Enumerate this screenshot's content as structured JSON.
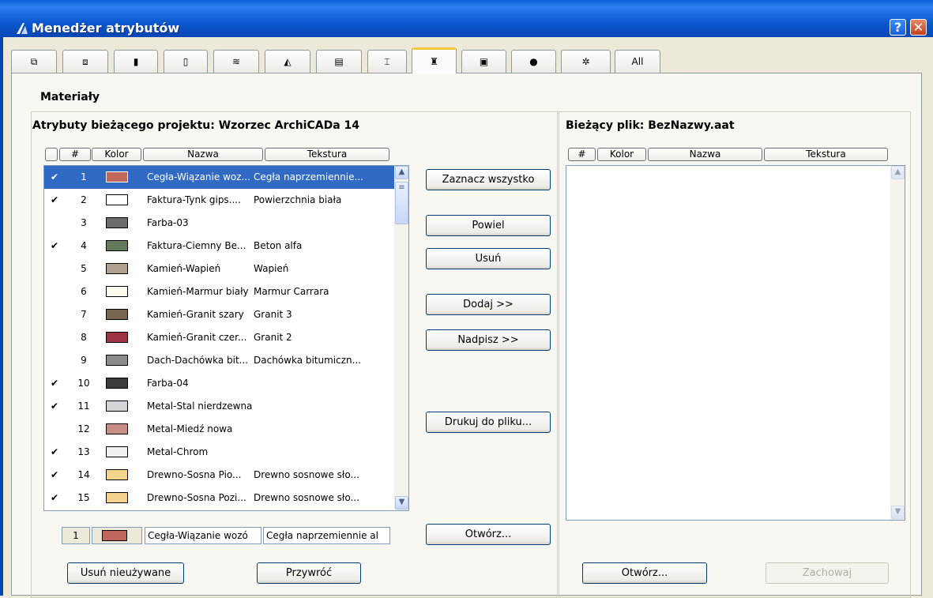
{
  "window": {
    "title": "Menedżer atrybutów",
    "help_label": "?",
    "close_label": "✕"
  },
  "tabs": [
    {
      "label": "",
      "icon": "layers-icon"
    },
    {
      "label": "",
      "icon": "layer-combinations-icon"
    },
    {
      "label": "",
      "icon": "pens-colors-icon"
    },
    {
      "label": "",
      "icon": "pen-sets-icon"
    },
    {
      "label": "",
      "icon": "line-types-icon"
    },
    {
      "label": "",
      "icon": "fill-types-icon"
    },
    {
      "label": "",
      "icon": "composites-icon"
    },
    {
      "label": "",
      "icon": "profiles-icon"
    },
    {
      "label": "",
      "icon": "materials-icon",
      "active": true
    },
    {
      "label": "",
      "icon": "zones-icon"
    },
    {
      "label": "",
      "icon": "cities-icon"
    },
    {
      "label": "",
      "icon": "mep-systems-icon"
    },
    {
      "label": "All",
      "icon": ""
    }
  ],
  "section_title": "Materiały",
  "left": {
    "title": "Atrybuty bieżącego projektu: Wzorzec ArchiCADa 14",
    "headers": {
      "check": "",
      "num": "#",
      "color": "Kolor",
      "name": "Nazwa",
      "texture": "Tekstura"
    },
    "rows": [
      {
        "checked": "✔",
        "num": "1",
        "color": "#c0665c",
        "name": "Cegła-Wiązanie woz...",
        "texture": "Cegła naprzemiennie...",
        "selected": true
      },
      {
        "checked": "✔",
        "num": "2",
        "color": "#ffffff",
        "name": "Faktura-Tynk gips....",
        "texture": "Powierzchnia biała"
      },
      {
        "checked": "",
        "num": "3",
        "color": "#6b6b6b",
        "name": "Farba-03",
        "texture": ""
      },
      {
        "checked": "✔",
        "num": "4",
        "color": "#637a5c",
        "name": "Faktura-Ciemny Be...",
        "texture": "Beton alfa"
      },
      {
        "checked": "",
        "num": "5",
        "color": "#b0a28c",
        "name": "Kamień-Wapień",
        "texture": "Wapień"
      },
      {
        "checked": "",
        "num": "6",
        "color": "#fcfbec",
        "name": "Kamień-Marmur biały",
        "texture": "Marmur Carrara"
      },
      {
        "checked": "",
        "num": "7",
        "color": "#7a6450",
        "name": "Kamień-Granit szary",
        "texture": "Granit 3"
      },
      {
        "checked": "",
        "num": "8",
        "color": "#9c3444",
        "name": "Kamień-Granit czer...",
        "texture": "Granit 2"
      },
      {
        "checked": "",
        "num": "9",
        "color": "#8c8c8c",
        "name": "Dach-Dachówka bit...",
        "texture": "Dachówka bitumiczn..."
      },
      {
        "checked": "✔",
        "num": "10",
        "color": "#3c3c3c",
        "name": "Farba-04",
        "texture": ""
      },
      {
        "checked": "✔",
        "num": "11",
        "color": "#d4d4d8",
        "name": "Metal-Stal nierdzewna",
        "texture": ""
      },
      {
        "checked": "",
        "num": "12",
        "color": "#c89084",
        "name": "Metal-Miedź nowa",
        "texture": ""
      },
      {
        "checked": "✔",
        "num": "13",
        "color": "#f0f0f0",
        "name": "Metal-Chrom",
        "texture": ""
      },
      {
        "checked": "✔",
        "num": "14",
        "color": "#f4d48c",
        "name": "Drewno-Sosna Pio...",
        "texture": "Drewno sosnowe sło..."
      },
      {
        "checked": "✔",
        "num": "15",
        "color": "#f4d48c",
        "name": "Drewno-Sosna Pozi...",
        "texture": "Drewno sosnowe sło..."
      }
    ],
    "edit": {
      "num": "1",
      "color": "#c0665c",
      "name": "Cegła-Wiązanie wozó",
      "texture": "Cegła naprzemiennie al"
    },
    "buttons": {
      "remove_unused": "Usuń nieużywane",
      "restore": "Przywróć"
    }
  },
  "middle": {
    "select_all": "Zaznacz wszystko",
    "duplicate": "Powiel",
    "delete": "Usuń",
    "add": "Dodaj >>",
    "overwrite": "Nadpisz >>",
    "print": "Drukuj do pliku...",
    "open": "Otwórz..."
  },
  "right": {
    "title": "Bieżący plik: BezNazwy.aat",
    "headers": {
      "num": "#",
      "color": "Kolor",
      "name": "Nazwa",
      "texture": "Tekstura"
    },
    "buttons": {
      "open": "Otwórz...",
      "save": "Zachowaj"
    }
  }
}
